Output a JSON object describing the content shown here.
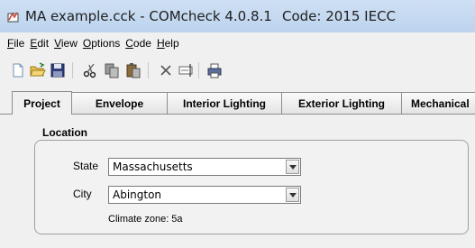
{
  "window": {
    "title": "MA example.cck - COMcheck 4.0.8.1",
    "code_label": "Code: 2015 IECC"
  },
  "menu": {
    "items": [
      {
        "label": "File",
        "accel": "F",
        "rest": "ile"
      },
      {
        "label": "Edit",
        "accel": "E",
        "rest": "dit"
      },
      {
        "label": "View",
        "accel": "V",
        "rest": "iew"
      },
      {
        "label": "Options",
        "accel": "O",
        "rest": "ptions"
      },
      {
        "label": "Code",
        "accel": "C",
        "rest": "ode"
      },
      {
        "label": "Help",
        "accel": "H",
        "rest": "elp"
      }
    ]
  },
  "toolbar": {
    "buttons": [
      "new-file-icon",
      "open-folder-icon",
      "save-icon",
      "cut-icon",
      "copy-icon",
      "paste-icon",
      "delete-icon",
      "rename-icon",
      "print-icon"
    ]
  },
  "tabs": [
    {
      "label": "Project",
      "active": true
    },
    {
      "label": "Envelope",
      "active": false
    },
    {
      "label": "Interior Lighting",
      "active": false
    },
    {
      "label": "Exterior Lighting",
      "active": false
    },
    {
      "label": "Mechanical",
      "active": false
    }
  ],
  "location": {
    "group_title": "Location",
    "state_label": "State",
    "state_value": "Massachusetts",
    "city_label": "City",
    "city_value": "Abington",
    "climate_zone": "Climate zone: 5a"
  }
}
